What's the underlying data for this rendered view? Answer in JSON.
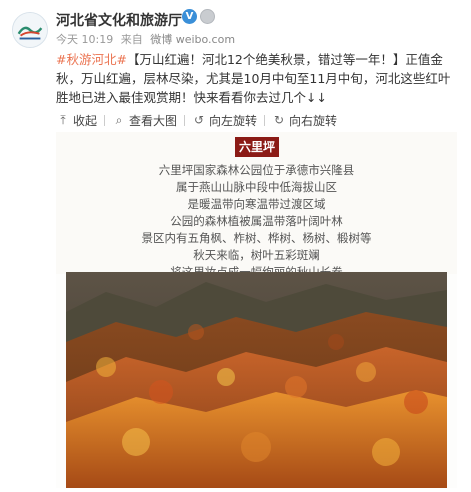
{
  "account": {
    "name": "河北省文化和旅游厅",
    "verified_mark": "V"
  },
  "meta": {
    "date": "今天 10:19",
    "source_prefix": "来自",
    "source": "微博 weibo.com"
  },
  "post": {
    "topic": "#秋游河北#",
    "body": "【万山红遍！河北12个绝美秋景，错过等一年！】正值金秋，万山红遍，层林尽染，尤其是10月中旬至11月中旬，河北这些红叶胜地已进入最佳观赏期！快来看看你去过几个↓↓"
  },
  "toolbar": {
    "collect": "收起",
    "view_large": "查看大图",
    "rotate_left": "向左旋转",
    "rotate_right": "向右旋转",
    "icons": [
      "collapse-icon",
      "magnifier-icon",
      "rotate-left-icon",
      "rotate-right-icon"
    ]
  },
  "image": {
    "title": "六里坪",
    "lines": [
      "六里坪国家森林公园位于承德市兴隆县",
      "属于燕山山脉中段中低海拔山区",
      "是暖温带向寒温带过渡区域",
      "公园的森林植被属温带落叶阔叶林",
      "景区内有五角枫、柞树、桦树、杨树、椴树等",
      "秋天来临，树叶五彩斑斓",
      "将这里妆点成一幅绚丽的秋山长卷"
    ]
  },
  "colors": {
    "topic": "#eb7350",
    "badge_bg": "#8b1b16",
    "verified": "#3a8fd8"
  }
}
